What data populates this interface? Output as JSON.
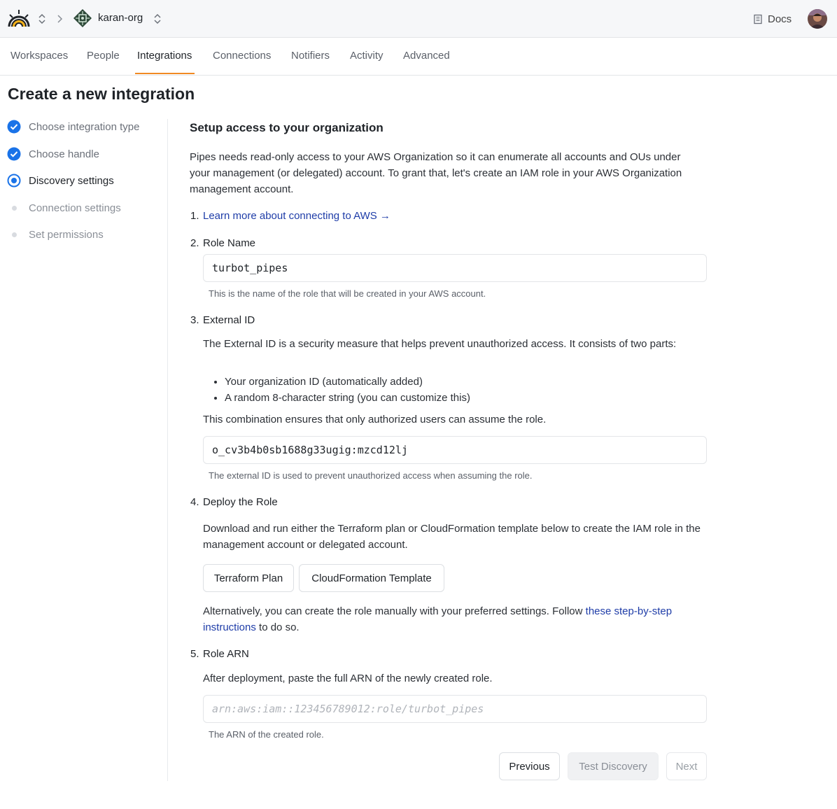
{
  "header": {
    "org_name": "karan-org",
    "docs_label": "Docs"
  },
  "tabs": [
    {
      "label": "Workspaces",
      "active": false
    },
    {
      "label": "People",
      "active": false
    },
    {
      "label": "Integrations",
      "active": true
    },
    {
      "label": "Connections",
      "active": false
    },
    {
      "label": "Notifiers",
      "active": false
    },
    {
      "label": "Activity",
      "active": false
    },
    {
      "label": "Advanced",
      "active": false
    }
  ],
  "page": {
    "title": "Create a new integration"
  },
  "steps": [
    {
      "label": "Choose integration type",
      "state": "done"
    },
    {
      "label": "Choose handle",
      "state": "done"
    },
    {
      "label": "Discovery settings",
      "state": "current"
    },
    {
      "label": "Connection settings",
      "state": "todo"
    },
    {
      "label": "Set permissions",
      "state": "todo"
    }
  ],
  "main": {
    "heading": "Setup access to your organization",
    "intro": "Pipes needs read-only access to your AWS Organization so it can enumerate all accounts and OUs under your management (or delegated) account. To grant that, let's create an IAM role in your AWS Organization management account.",
    "item1": {
      "number": "1.",
      "link": "Learn more about connecting to AWS →"
    },
    "item2": {
      "number": "2.",
      "title": "Role Name",
      "value": "turbot_pipes",
      "help": "This is the name of the role that will be created in your AWS account."
    },
    "item3": {
      "number": "3.",
      "title": "External ID",
      "description": "The External ID is a security measure that helps prevent unauthorized access. It consists of two parts:",
      "bullets": [
        "Your organization ID (automatically added)",
        "A random 8-character string (you can customize this)"
      ],
      "note": "This combination ensures that only authorized users can assume the role.",
      "value": "o_cv3b4b0sb1688g33ugig:mzcd12lj",
      "help": "The external ID is used to prevent unauthorized access when assuming the role."
    },
    "item4": {
      "number": "4.",
      "title": "Deploy the Role",
      "description": "Download and run either the Terraform plan or CloudFormation template below to create the IAM role in the management account or delegated account.",
      "terraform_button": "Terraform Plan",
      "cloudformation_button": "CloudFormation Template",
      "alt_text_before": "Alternatively, you can create the role manually with your preferred settings. Follow ",
      "alt_link": "these step-by-step instructions",
      "alt_text_after": " to do so."
    },
    "item5": {
      "number": "5.",
      "title": "Role ARN",
      "description": "After deployment, paste the full ARN of the newly created role.",
      "placeholder": "arn:aws:iam::123456789012:role/turbot_pipes",
      "help": "The ARN of the created role."
    }
  },
  "footer": {
    "previous": "Previous",
    "test_discovery": "Test Discovery",
    "next": "Next"
  },
  "colors": {
    "accent_blue": "#1a73e8",
    "tab_underline": "#f08a24",
    "link": "#1f3da8"
  }
}
